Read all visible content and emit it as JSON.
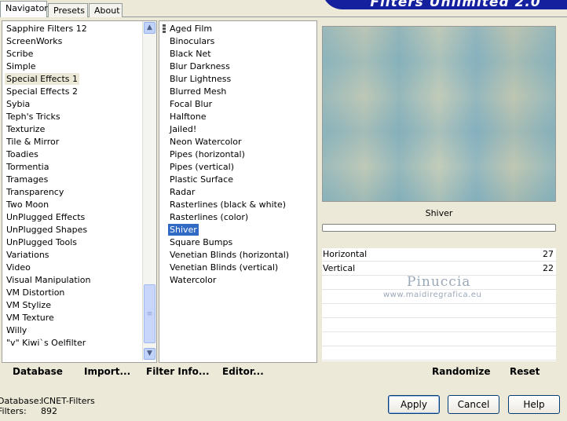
{
  "app": {
    "banner_title": "Filters Unlimited 2.0"
  },
  "tabs": [
    {
      "label": "Navigator",
      "active": true
    },
    {
      "label": "Presets",
      "active": false
    },
    {
      "label": "About",
      "active": false
    }
  ],
  "categories": {
    "items": [
      "Sapphire Filters 12",
      "ScreenWorks",
      "Scribe",
      "Simple",
      "Special Effects 1",
      "Special Effects 2",
      "Sybia",
      "Teph's Tricks",
      "Texturize",
      "Tile & Mirror",
      "Toadies",
      "Tormentia",
      "Tramages",
      "Transparency",
      "Two Moon",
      "UnPlugged Effects",
      "UnPlugged Shapes",
      "UnPlugged Tools",
      "Variations",
      "Video",
      "Visual Manipulation",
      "VM Distortion",
      "VM Stylize",
      "VM Texture",
      "Willy",
      "\"v\" Kiwi`s Oelfilter"
    ],
    "selected": "Special Effects 1"
  },
  "filters": {
    "items": [
      "Aged Film",
      "Binoculars",
      "Black Net",
      "Blur Darkness",
      "Blur Lightness",
      "Blurred Mesh",
      "Focal Blur",
      "Halftone",
      "Jailed!",
      "Neon Watercolor",
      "Pipes (horizontal)",
      "Pipes (vertical)",
      "Plastic Surface",
      "Radar",
      "Rasterlines (black & white)",
      "Rasterlines (color)",
      "Shiver",
      "Square Bumps",
      "Venetian Blinds (horizontal)",
      "Venetian Blinds (vertical)",
      "Watercolor"
    ],
    "selected": "Shiver"
  },
  "filter_panel": {
    "name": "Shiver",
    "progress_percent": 0,
    "params": [
      {
        "label": "Horizontal",
        "value": "27"
      },
      {
        "label": "Vertical",
        "value": "22"
      }
    ],
    "watermark_name": "Pinuccia",
    "watermark_url": "www.maidiregrafica.eu"
  },
  "toolbar": {
    "database_label": "Database",
    "import_label": "Import...",
    "filter_info_label": "Filter Info...",
    "editor_label": "Editor...",
    "randomize_label": "Randomize",
    "reset_label": "Reset"
  },
  "status": {
    "database_label": "Database:",
    "database_value": "ICNET-Filters",
    "filters_label": "Filters:",
    "filters_value": "892"
  },
  "buttons": {
    "apply": "Apply",
    "cancel": "Cancel",
    "help": "Help"
  },
  "colors": {
    "banner": "#15209f",
    "selection_active": "#316ac5",
    "selection_inactive": "#ece9d8"
  }
}
